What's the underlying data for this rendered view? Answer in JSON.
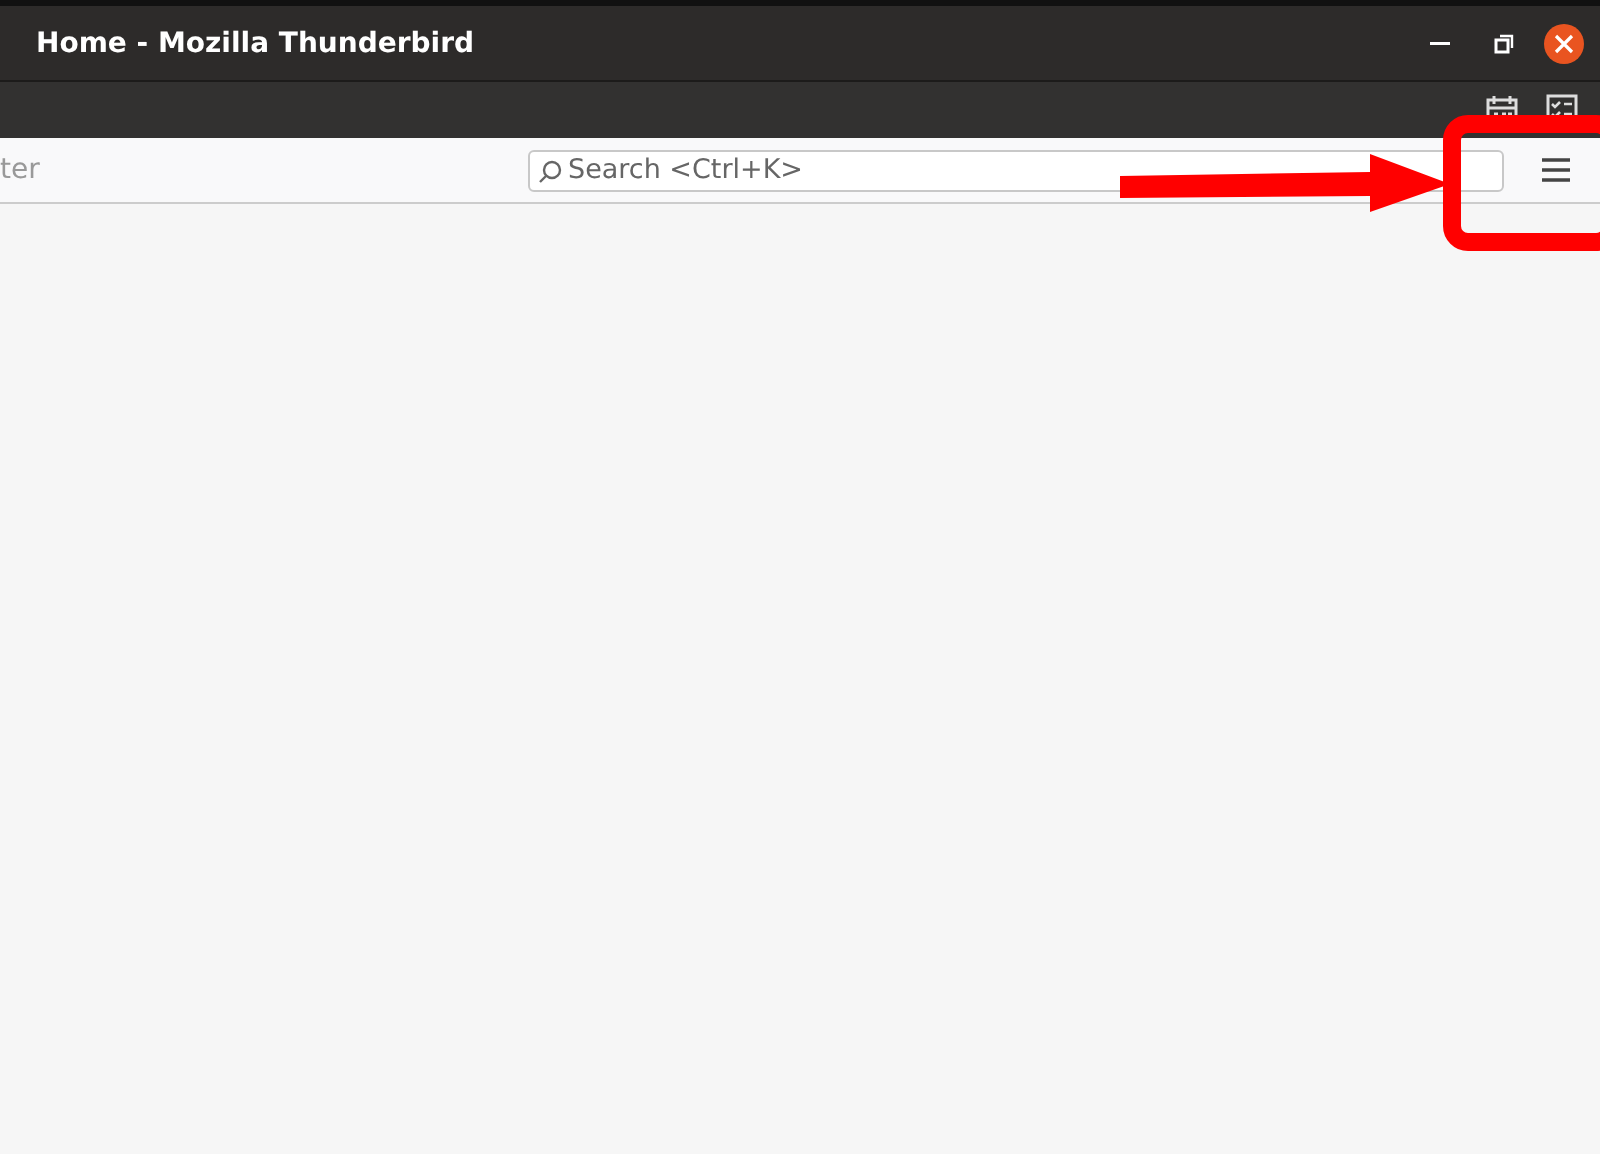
{
  "window": {
    "title": "Home - Mozilla Thunderbird"
  },
  "toolbar": {
    "filter_placeholder": "ter",
    "search_placeholder": "Search <Ctrl+K>"
  }
}
